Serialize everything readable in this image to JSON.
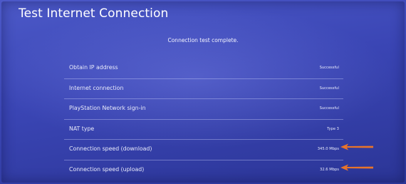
{
  "screen": {
    "title": "Test Internet Connection",
    "status_message": "Connection test complete."
  },
  "results": [
    {
      "label": "Obtain IP address",
      "value": "Successful"
    },
    {
      "label": "Internet connection",
      "value": "Successful"
    },
    {
      "label": "PlayStation Network sign-in",
      "value": "Successful"
    },
    {
      "label": "NAT type",
      "value": "Type 3"
    },
    {
      "label": "Connection speed (download)",
      "value": "345.0 Mbps"
    },
    {
      "label": "Connection speed (upload)",
      "value": "32.6 Mbps"
    }
  ],
  "annotations": {
    "arrow_color": "#e8742a",
    "arrow_icon": "arrow-left-icon"
  },
  "colors": {
    "background": "#3a45b4",
    "text": "#eef0fb"
  }
}
